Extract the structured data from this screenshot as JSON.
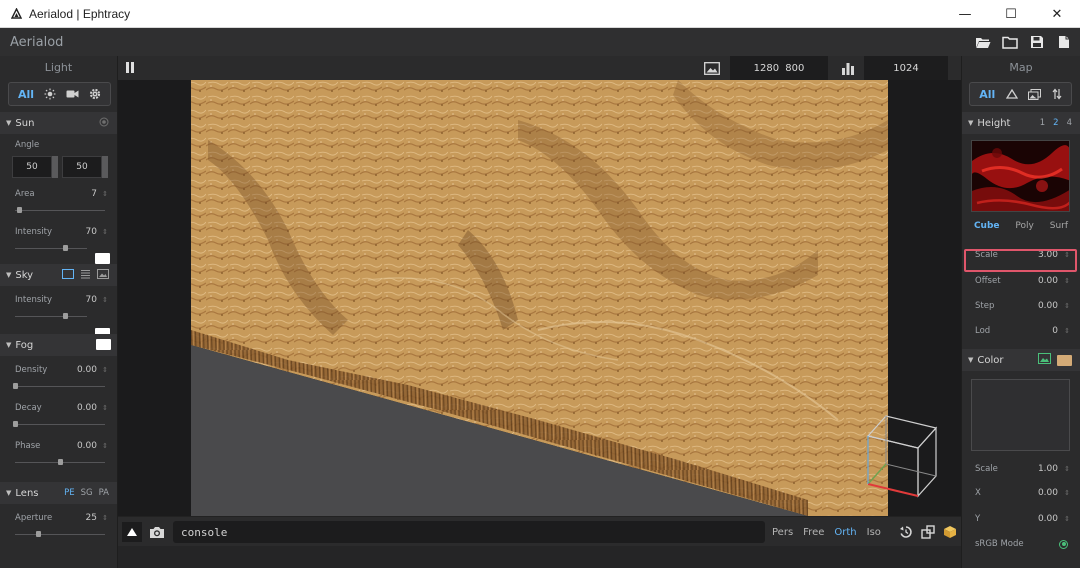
{
  "window": {
    "title": "Aerialod | Ephtracy",
    "minimize": "—",
    "maximize": "☐",
    "close": "✕"
  },
  "app": {
    "brand": "Aerialod"
  },
  "left_panel": {
    "title": "Light",
    "filter_all": "All",
    "sun": {
      "title": "Sun",
      "angle_label": "Angle",
      "angle_values": [
        "50",
        "50"
      ],
      "area_label": "Area",
      "area_value": "7",
      "area_level": 0.04,
      "intensity_label": "Intensity",
      "intensity_value": "70",
      "intensity_level": 0.7
    },
    "sky": {
      "title": "Sky",
      "intensity_label": "Intensity",
      "intensity_value": "70",
      "intensity_level": 0.7
    },
    "fog": {
      "title": "Fog",
      "density_label": "Density",
      "density_value": "0.00",
      "density_level": 0.0,
      "decay_label": "Decay",
      "decay_value": "0.00",
      "decay_level": 0.0,
      "phase_label": "Phase",
      "phase_value": "0.00",
      "phase_level": 0.5
    },
    "lens": {
      "title": "Lens",
      "tabs": [
        "PE",
        "SG",
        "PA"
      ],
      "aperture_label": "Aperture",
      "aperture_value": "25",
      "aperture_level": 0.25
    }
  },
  "viewport": {
    "resolution": "1280 800",
    "samples": "1024",
    "colors": {
      "terrain": "#c79a5a",
      "ground": "#4a4a4c",
      "background": "#1b1b1c"
    }
  },
  "bottom_bar": {
    "console_text": "console",
    "modes": [
      "Pers",
      "Free",
      "Orth",
      "Iso"
    ],
    "active_mode": "Orth"
  },
  "right_panel": {
    "title": "Map",
    "filter_all": "All",
    "height": {
      "title": "Height",
      "levels": [
        "1",
        "2",
        "4"
      ],
      "active_level": "2",
      "tabs": [
        "Cube",
        "Poly",
        "Surf"
      ],
      "scale_label": "Scale",
      "scale_value": "3.00",
      "offset_label": "Offset",
      "offset_value": "0.00",
      "step_label": "Step",
      "step_value": "0.00",
      "lod_label": "Lod",
      "lod_value": "0"
    },
    "color": {
      "title": "Color",
      "swatch": "#d4ab77",
      "scale_label": "Scale",
      "scale_value": "1.00",
      "x_label": "X",
      "x_value": "0.00",
      "y_label": "Y",
      "y_value": "0.00",
      "srgb_label": "sRGB Mode"
    }
  }
}
